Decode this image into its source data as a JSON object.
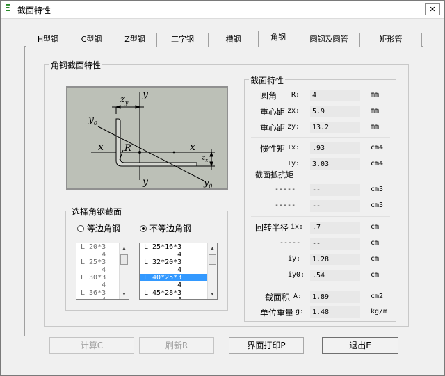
{
  "window": {
    "title": "截面特性",
    "close_glyph": "✕",
    "app_glyph": "Ξ"
  },
  "tabs": [
    {
      "label": "H型钢"
    },
    {
      "label": "C型钢"
    },
    {
      "label": "Z型钢"
    },
    {
      "label": "工字钢"
    },
    {
      "label": "槽钢"
    },
    {
      "label": "角钢"
    },
    {
      "label": "圆钢及圆管"
    },
    {
      "label": "矩形管"
    }
  ],
  "active_tab": "角钢",
  "figure_group": {
    "title": "角钢截面特性"
  },
  "figure": {
    "zy": "z",
    "zy_sub": "y",
    "y_top": "y",
    "y0_left": "y",
    "y0_sub": "0",
    "x_left": "x",
    "x_right": "x",
    "R": "R",
    "y_bottom": "y",
    "y0_right": "y",
    "y0_right_sub": "0",
    "zx": "z",
    "zx_sub": "x"
  },
  "select_group": {
    "title": "选择角钢截面",
    "radio_equal": "等边角钢",
    "radio_unequal": "不等边角钢",
    "equal_list": [
      "L 20*3",
      "     4",
      "L 25*3",
      "     4",
      "L 30*3",
      "     4",
      "L 36*3",
      "     4"
    ],
    "unequal_list": [
      "L 25*16*3",
      "        4",
      "L 32*20*3",
      "        4",
      "L 40*25*3",
      "        4",
      "L 45*28*3",
      "        4"
    ],
    "selected_unequal": "L 40*25*3"
  },
  "props_group": {
    "title": "截面特性",
    "rows": {
      "R": {
        "label": "圆角",
        "sym": "R:",
        "value": "4",
        "unit": "mm"
      },
      "zx": {
        "label": "重心距",
        "sym": "zx:",
        "value": "5.9",
        "unit": "mm"
      },
      "zy": {
        "label": "重心距",
        "sym": "zy:",
        "value": "13.2",
        "unit": "mm"
      },
      "Ix": {
        "label": "惯性矩",
        "sym": "Ix:",
        "value": ".93",
        "unit": "cm4"
      },
      "Iy": {
        "label": "",
        "sym": "Iy:",
        "value": "3.03",
        "unit": "cm4"
      },
      "wsub": {
        "label": "截面抵抗矩"
      },
      "W1": {
        "label": "-----",
        "value": "--",
        "unit": "cm3"
      },
      "W2": {
        "label": "-----",
        "value": "--",
        "unit": "cm3"
      },
      "ix": {
        "label": "回转半径",
        "sym": "ix:",
        "value": ".7",
        "unit": "cm"
      },
      "dash": {
        "label": "-----",
        "value": "--",
        "unit": "cm"
      },
      "iy": {
        "label": "",
        "sym": "iy:",
        "value": "1.28",
        "unit": "cm"
      },
      "iy0": {
        "label": "",
        "sym": "iy0:",
        "value": ".54",
        "unit": "cm"
      },
      "A": {
        "label": "截面积",
        "sym": "A:",
        "value": "1.89",
        "unit": "cm2"
      },
      "g": {
        "label": "单位重量",
        "sym": "g:",
        "value": "1.48",
        "unit": "kg/m"
      }
    }
  },
  "buttons": {
    "calc": "计算C",
    "refresh": "刷新R",
    "print": "界面打印P",
    "exit": "退出E"
  }
}
